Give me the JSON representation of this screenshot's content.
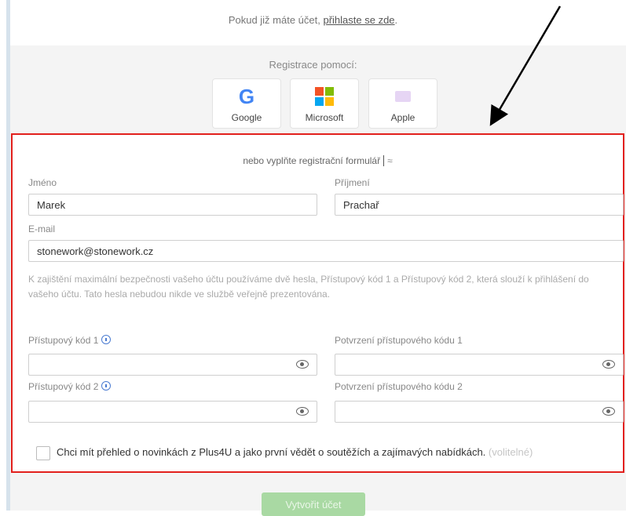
{
  "top": {
    "text_before_link": "Pokud již máte účet, ",
    "link": "přihlaste se zde",
    "text_after_link": "."
  },
  "registration": {
    "label": "Registrace pomocí:",
    "providers": [
      {
        "name": "Google",
        "icon": "google-icon"
      },
      {
        "name": "Microsoft",
        "icon": "microsoft-icon"
      },
      {
        "name": "Apple",
        "icon": "apple-icon"
      }
    ]
  },
  "form": {
    "or_text": "nebo vyplňte registrační formulář",
    "collapse_icon": "double-chevron-up-icon",
    "first_name": {
      "label": "Jméno",
      "value": "Marek"
    },
    "last_name": {
      "label": "Příjmení",
      "value": "Prachař"
    },
    "email": {
      "label": "E-mail",
      "value": "stonework@stonework.cz"
    },
    "hint": "K zajištění maximální bezpečnosti vašeho účtu používáme dvě hesla, Přístupový kód 1 a Přístupový kód 2, která slouží k přihlášení do vašeho účtu. Tato hesla nebudou nikde ve službě veřejně prezentována.",
    "access_code_1": {
      "label": "Přístupový kód 1",
      "value": ""
    },
    "confirm_code_1": {
      "label": "Potvrzení přístupového kódu 1",
      "value": ""
    },
    "access_code_2": {
      "label": "Přístupový kód 2",
      "value": ""
    },
    "confirm_code_2": {
      "label": "Potvrzení přístupového kódu 2",
      "value": ""
    },
    "newsletter": {
      "text": "Chci mít přehled o novinkách z Plus4U a jako první vědět o soutěžích a zajímavých nabídkách.",
      "link": "(volitelné)",
      "checked": false
    }
  },
  "submit_label": "Vytvořit účet",
  "colors": {
    "highlight_border": "#e2201c",
    "submit": "#a9d9a3",
    "info_icon": "#4a7bd1"
  }
}
